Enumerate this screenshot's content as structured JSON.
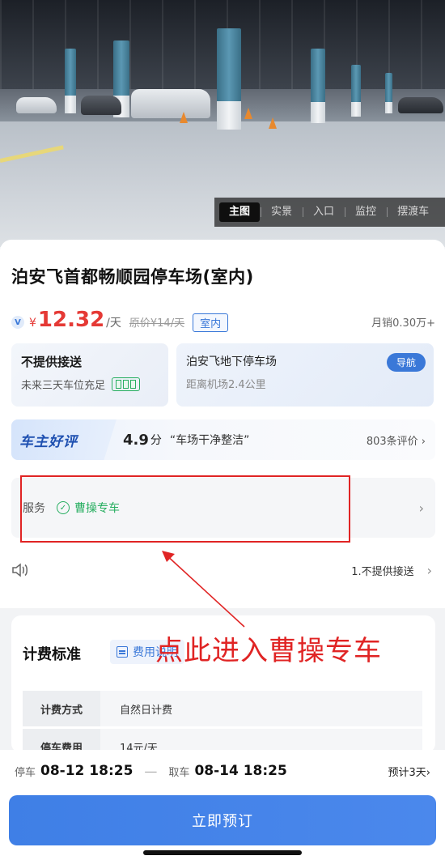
{
  "hero": {
    "tabs": [
      "主图",
      "实景",
      "入口",
      "监控",
      "摆渡车"
    ],
    "active_tab": 0
  },
  "parking": {
    "title": "泊安飞首都畅顺园停车场(室内)",
    "vip_mark": "V",
    "currency": "¥",
    "price": "12.32",
    "unit": "/天",
    "original_price": "原价¥14/天",
    "tag": "室内",
    "monthly_sales": "月销0.30万+"
  },
  "shuttle": {
    "title": "不提供接送",
    "subtitle": "未来三天车位充足"
  },
  "location": {
    "name": "泊安飞地下停车场",
    "distance": "距离机场2.4公里",
    "nav_label": "导航"
  },
  "review": {
    "badge": "车主好评",
    "score": "4.9",
    "score_unit": "分",
    "quote": "“车场干净整洁”",
    "count": "803条评价 ›"
  },
  "service": {
    "label": "服务",
    "check": "✓",
    "name": "曹操专车",
    "chevron": "›"
  },
  "notice": {
    "text": "1.不提供接送",
    "chevron": "›"
  },
  "annotation": {
    "text": "点此进入曹操专车",
    "color": "#e02424"
  },
  "fee": {
    "title": "计费标准",
    "link": "费用说明",
    "rows": [
      {
        "key": "计费方式",
        "value": "自然日计费"
      },
      {
        "key": "停车费用",
        "value": "14元/天"
      }
    ]
  },
  "booking": {
    "park_label": "停车",
    "park_time": "08-12 18:25",
    "dash": "—",
    "pick_label": "取车",
    "pick_time": "08-14 18:25",
    "estimate": "预计3天›",
    "button": "立即预订"
  },
  "colors": {
    "accent": "#3a78d8",
    "price": "#e53935",
    "success": "#27ae60",
    "annotation": "#e02424"
  }
}
